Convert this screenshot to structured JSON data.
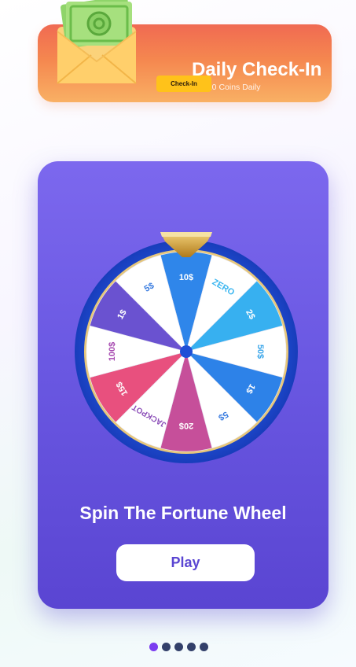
{
  "checkin": {
    "title": "Daily Check-In",
    "subtitle": "Get 20 Coins Daily",
    "button_label": "Check-In"
  },
  "spin": {
    "title": "Spin The Fortune Wheel",
    "play_label": "Play"
  },
  "wheel": {
    "segments": [
      {
        "label": "10$",
        "color": "#2f86ea",
        "text": "#ffffff"
      },
      {
        "label": "ZERO",
        "color": "#ffffff",
        "text": "#3bb6f0"
      },
      {
        "label": "2$",
        "color": "#37b0f0",
        "text": "#ffffff"
      },
      {
        "label": "50$",
        "color": "#ffffff",
        "text": "#3aa6ea"
      },
      {
        "label": "1$",
        "color": "#2d82e8",
        "text": "#ffffff"
      },
      {
        "label": "5$",
        "color": "#ffffff",
        "text": "#3b7de0"
      },
      {
        "label": "20$",
        "color": "#c64f9a",
        "text": "#ffffff"
      },
      {
        "label": "JACKPOT",
        "color": "#ffffff",
        "text": "#8c4fb8"
      },
      {
        "label": "15$",
        "color": "#e8507e",
        "text": "#ffffff"
      },
      {
        "label": "100$",
        "color": "#ffffff",
        "text": "#a74ab0"
      },
      {
        "label": "1$",
        "color": "#6a52d0",
        "text": "#ffffff"
      },
      {
        "label": "5$",
        "color": "#ffffff",
        "text": "#3b7de0"
      }
    ]
  },
  "pager": {
    "count": 5,
    "active": 0
  }
}
